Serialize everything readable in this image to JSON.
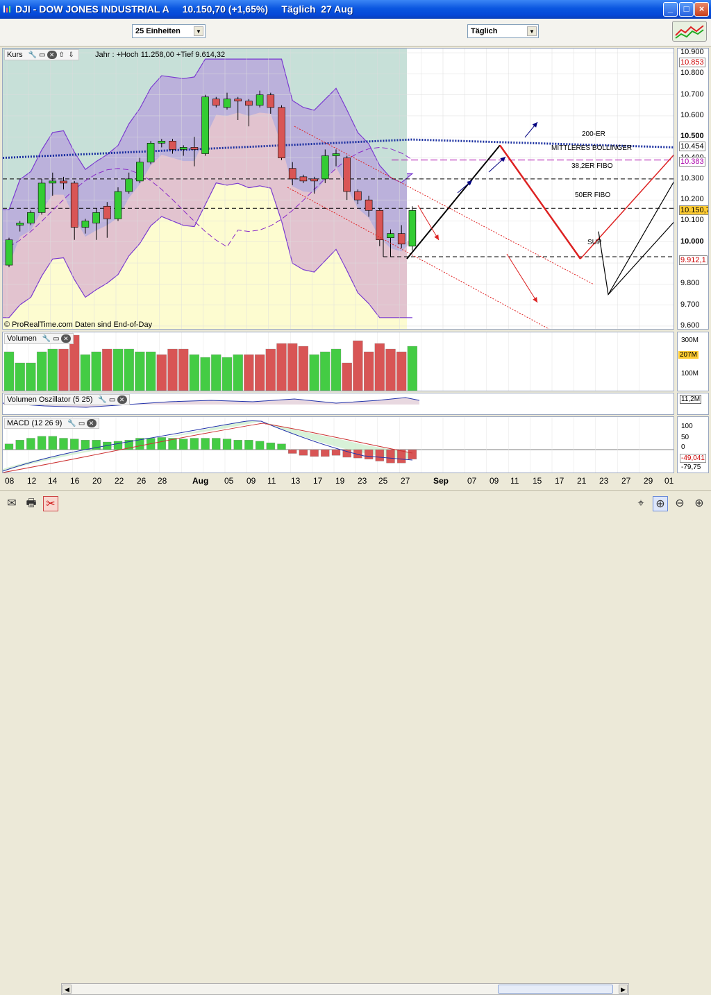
{
  "window": {
    "title": "DJI - DOW JONES INDUSTRIAL A     10.150,70 (+1,65%)     Täglich  27 Aug",
    "buttons": [
      "_",
      "□",
      "×"
    ]
  },
  "toolbar": {
    "units_select": "25 Einheiten",
    "period_select": "Täglich"
  },
  "price_panel": {
    "title": "Kurs",
    "info": "Jahr : +Hoch 11.258,00 +Tief 9.614,32",
    "copyright": "© ProRealTime.com  Daten sind End-of-Day",
    "annotations": [
      "200-ER",
      "MITTLERES BOLLINGER",
      "38,2ER FIBO",
      "50ER FIBO",
      "SUP"
    ],
    "scale_ticks": [
      "10.900",
      "10.800",
      "10.700",
      "10.600",
      "10.500",
      "10.400",
      "10.300",
      "10.200",
      "10.100",
      "10.000",
      "9.900",
      "9.800",
      "9.700",
      "9.600"
    ],
    "scale_markers": [
      {
        "label": "10.853",
        "color": "#cc0000",
        "bg": "#ffffff",
        "value": 10853
      },
      {
        "label": "10.454",
        "color": "#000000",
        "bg": "#ffffff",
        "value": 10454
      },
      {
        "label": "10.383",
        "color": "#aa00aa",
        "bg": "#ffffff",
        "value": 10383
      },
      {
        "label": "10.150,7",
        "color": "#000000",
        "bg": "#ffcc33",
        "value": 10150.7
      },
      {
        "label": "9.912,1",
        "color": "#cc0000",
        "bg": "#ffffff",
        "value": 9912.1
      }
    ],
    "colors": {
      "up": "#33cc33",
      "down": "#d95555",
      "ma": "#1a2fa0"
    }
  },
  "volume_panel": {
    "title": "Volumen",
    "scale_ticks": [
      "300M",
      "200M",
      "100M"
    ],
    "marker": "207M"
  },
  "vol_osc_panel": {
    "title": "Volumen Oszillator (5 25)",
    "marker": "11,2M"
  },
  "macd_panel": {
    "title": "MACD (12 26 9)",
    "scale_ticks": [
      "100",
      "50",
      "0",
      "-50"
    ],
    "markers": [
      "-49,041",
      "-79,75"
    ]
  },
  "x_axis": {
    "labels": [
      "08",
      "12",
      "14",
      "16",
      "20",
      "22",
      "26",
      "28",
      "Aug",
      "05",
      "09",
      "11",
      "13",
      "17",
      "19",
      "23",
      "25",
      "27",
      "Sep",
      "07",
      "09",
      "11",
      "15",
      "17",
      "21",
      "23",
      "27",
      "29",
      "01"
    ]
  },
  "chart_data": {
    "type": "candlestick",
    "title": "DJI - DOW JONES INDUSTRIAL A",
    "ylim": [
      9580,
      10920
    ],
    "candles": [
      {
        "o": 9890,
        "h": 10020,
        "l": 9880,
        "c": 10010
      },
      {
        "o": 10080,
        "h": 10100,
        "l": 10050,
        "c": 10090
      },
      {
        "o": 10090,
        "h": 10150,
        "l": 10080,
        "c": 10140
      },
      {
        "o": 10140,
        "h": 10300,
        "l": 10130,
        "c": 10280
      },
      {
        "o": 10280,
        "h": 10330,
        "l": 10220,
        "c": 10290
      },
      {
        "o": 10290,
        "h": 10310,
        "l": 10250,
        "c": 10280
      },
      {
        "o": 10280,
        "h": 10290,
        "l": 10010,
        "c": 10070
      },
      {
        "o": 10070,
        "h": 10110,
        "l": 10040,
        "c": 10100
      },
      {
        "o": 10090,
        "h": 10160,
        "l": 10010,
        "c": 10140
      },
      {
        "o": 10170,
        "h": 10190,
        "l": 10020,
        "c": 10110
      },
      {
        "o": 10110,
        "h": 10260,
        "l": 10100,
        "c": 10240
      },
      {
        "o": 10240,
        "h": 10330,
        "l": 10230,
        "c": 10300
      },
      {
        "o": 10290,
        "h": 10400,
        "l": 10280,
        "c": 10380
      },
      {
        "o": 10380,
        "h": 10480,
        "l": 10370,
        "c": 10470
      },
      {
        "o": 10470,
        "h": 10490,
        "l": 10450,
        "c": 10480
      },
      {
        "o": 10480,
        "h": 10490,
        "l": 10420,
        "c": 10440
      },
      {
        "o": 10440,
        "h": 10460,
        "l": 10410,
        "c": 10450
      },
      {
        "o": 10450,
        "h": 10500,
        "l": 10360,
        "c": 10440
      },
      {
        "o": 10420,
        "h": 10700,
        "l": 10410,
        "c": 10690
      },
      {
        "o": 10680,
        "h": 10690,
        "l": 10640,
        "c": 10650
      },
      {
        "o": 10640,
        "h": 10710,
        "l": 10630,
        "c": 10680
      },
      {
        "o": 10680,
        "h": 10690,
        "l": 10580,
        "c": 10670
      },
      {
        "o": 10670,
        "h": 10680,
        "l": 10550,
        "c": 10650
      },
      {
        "o": 10650,
        "h": 10720,
        "l": 10640,
        "c": 10700
      },
      {
        "o": 10700,
        "h": 10710,
        "l": 10610,
        "c": 10640
      },
      {
        "o": 10640,
        "h": 10650,
        "l": 10390,
        "c": 10400
      },
      {
        "o": 10350,
        "h": 10380,
        "l": 10270,
        "c": 10300
      },
      {
        "o": 10310,
        "h": 10320,
        "l": 10280,
        "c": 10290
      },
      {
        "o": 10300,
        "h": 10310,
        "l": 10230,
        "c": 10290
      },
      {
        "o": 10300,
        "h": 10440,
        "l": 10280,
        "c": 10410
      },
      {
        "o": 10410,
        "h": 10440,
        "l": 10360,
        "c": 10420
      },
      {
        "o": 10400,
        "h": 10410,
        "l": 10200,
        "c": 10240
      },
      {
        "o": 10240,
        "h": 10250,
        "l": 10180,
        "c": 10200
      },
      {
        "o": 10200,
        "h": 10220,
        "l": 10120,
        "c": 10150
      },
      {
        "o": 10150,
        "h": 10160,
        "l": 9980,
        "c": 10010
      },
      {
        "o": 10020,
        "h": 10060,
        "l": 9930,
        "c": 10040
      },
      {
        "o": 10040,
        "h": 10080,
        "l": 9970,
        "c": 9990
      },
      {
        "o": 9980,
        "h": 10170,
        "l": 9960,
        "c": 10150
      }
    ],
    "volume": [
      {
        "v": 140,
        "up": true
      },
      {
        "v": 100,
        "up": true
      },
      {
        "v": 100,
        "up": true
      },
      {
        "v": 140,
        "up": true
      },
      {
        "v": 150,
        "up": true
      },
      {
        "v": 150,
        "up": false
      },
      {
        "v": 200,
        "up": false
      },
      {
        "v": 130,
        "up": true
      },
      {
        "v": 140,
        "up": true
      },
      {
        "v": 150,
        "up": false
      },
      {
        "v": 150,
        "up": true
      },
      {
        "v": 150,
        "up": true
      },
      {
        "v": 140,
        "up": true
      },
      {
        "v": 140,
        "up": true
      },
      {
        "v": 130,
        "up": false
      },
      {
        "v": 150,
        "up": false
      },
      {
        "v": 150,
        "up": false
      },
      {
        "v": 130,
        "up": true
      },
      {
        "v": 120,
        "up": true
      },
      {
        "v": 130,
        "up": true
      },
      {
        "v": 120,
        "up": true
      },
      {
        "v": 130,
        "up": true
      },
      {
        "v": 130,
        "up": false
      },
      {
        "v": 130,
        "up": false
      },
      {
        "v": 150,
        "up": false
      },
      {
        "v": 170,
        "up": false
      },
      {
        "v": 170,
        "up": false
      },
      {
        "v": 160,
        "up": false
      },
      {
        "v": 130,
        "up": true
      },
      {
        "v": 140,
        "up": true
      },
      {
        "v": 150,
        "up": true
      },
      {
        "v": 100,
        "up": false
      },
      {
        "v": 180,
        "up": false
      },
      {
        "v": 140,
        "up": false
      },
      {
        "v": 170,
        "up": false
      },
      {
        "v": 150,
        "up": false
      },
      {
        "v": 140,
        "up": false
      },
      {
        "v": 160,
        "up": true
      }
    ],
    "macd_hist": [
      15,
      25,
      30,
      35,
      35,
      30,
      28,
      25,
      25,
      20,
      22,
      25,
      30,
      30,
      32,
      30,
      28,
      30,
      30,
      30,
      28,
      25,
      25,
      22,
      18,
      15,
      -10,
      -15,
      -18,
      -18,
      -15,
      -20,
      -22,
      -25,
      -30,
      -35,
      -35,
      -25
    ]
  }
}
